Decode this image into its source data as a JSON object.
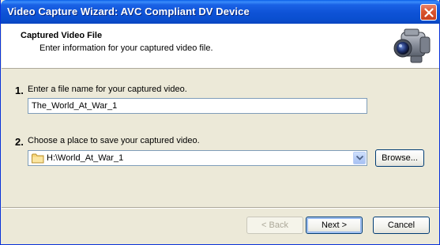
{
  "window": {
    "title": "Video Capture Wizard: AVC Compliant DV Device"
  },
  "header": {
    "title": "Captured Video File",
    "subtitle": "Enter information for your captured video file."
  },
  "step1": {
    "number": "1.",
    "label": "Enter a file name for your captured video.",
    "filename": "The_World_At_War_1"
  },
  "step2": {
    "number": "2.",
    "label": "Choose a place to save your captured video.",
    "location": "H:\\World_At_War_1",
    "browse_label": "Browse..."
  },
  "footer": {
    "back_label": "< Back",
    "next_label": "Next >",
    "cancel_label": "Cancel"
  },
  "icons": {
    "close": "close-icon",
    "camera": "camcorder-icon",
    "folder": "folder-icon",
    "dropdown": "chevron-down-icon"
  },
  "colors": {
    "titlebar": "#0a4fd0",
    "close_button": "#d9552f",
    "dialog_bg": "#ece9d8",
    "input_border": "#7f9db9",
    "button_border": "#003c74"
  }
}
